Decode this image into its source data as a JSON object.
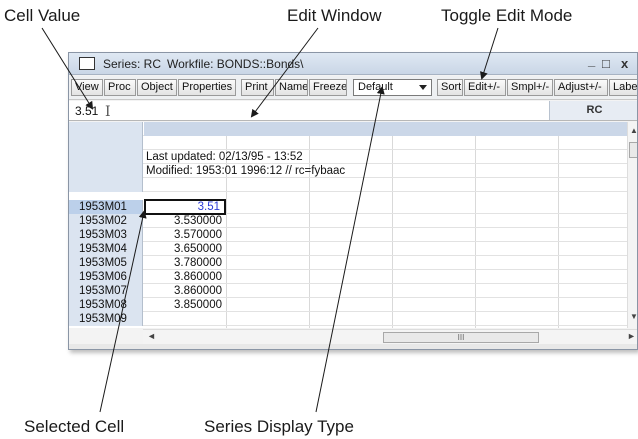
{
  "annotations": {
    "cell_value": "Cell Value",
    "edit_window": "Edit Window",
    "toggle_edit_mode": "Toggle Edit Mode",
    "selected_cell": "Selected Cell",
    "series_display_type": "Series Display Type"
  },
  "window": {
    "title": "Series: RC",
    "workfile": "Workfile: BONDS::Bonds\\",
    "minimize": "_",
    "maximize": "□",
    "close": "x"
  },
  "toolbar": {
    "view": "View",
    "proc": "Proc",
    "object": "Object",
    "properties": "Properties",
    "print": "Print",
    "name": "Name",
    "freeze": "Freeze",
    "display_type": "Default",
    "sort": "Sort",
    "edit": "Edit+/-",
    "smpl": "Smpl+/-",
    "adjust": "Adjust+/-",
    "label": "Label"
  },
  "edit_window": {
    "value": "3.51",
    "series_name": "RC"
  },
  "grid": {
    "last_updated": "Last updated: 02/13/95 - 13:52",
    "modified": "Modified: 1953:01 1996:12 // rc=fybaac",
    "rows": [
      {
        "date": "1953M01",
        "value": "3.51"
      },
      {
        "date": "1953M02",
        "value": "3.530000"
      },
      {
        "date": "1953M03",
        "value": "3.570000"
      },
      {
        "date": "1953M04",
        "value": "3.650000"
      },
      {
        "date": "1953M05",
        "value": "3.780000"
      },
      {
        "date": "1953M06",
        "value": "3.860000"
      },
      {
        "date": "1953M07",
        "value": "3.860000"
      },
      {
        "date": "1953M08",
        "value": "3.850000"
      },
      {
        "date": "1953M09",
        "value": ""
      }
    ]
  },
  "icons": {
    "ibeam": "I",
    "scroll_up": "▲",
    "scroll_down": "▼",
    "scroll_left": "◄",
    "scroll_right": "►",
    "grip": "III"
  }
}
